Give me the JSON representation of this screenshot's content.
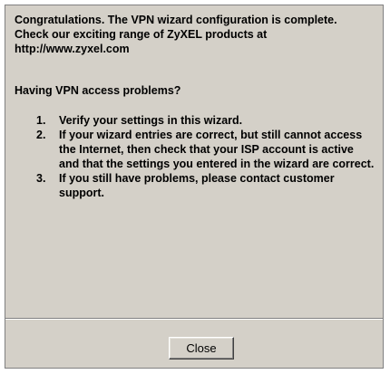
{
  "dialog": {
    "intro_lines": [
      "Congratulations. The VPN wizard configuration is complete.",
      "Check our exciting range of ZyXEL products at http://www.zyxel.com"
    ],
    "problems_heading": "Having VPN access problems?",
    "steps": [
      {
        "number": "1.",
        "text": "Verify your settings in this wizard."
      },
      {
        "number": "2.",
        "text": "If your wizard entries are correct, but still cannot access the Internet, then check that your ISP account is active and that the settings you entered in the wizard are correct."
      },
      {
        "number": "3.",
        "text": "If you still have problems, please contact customer support."
      }
    ],
    "close_label": "Close"
  }
}
